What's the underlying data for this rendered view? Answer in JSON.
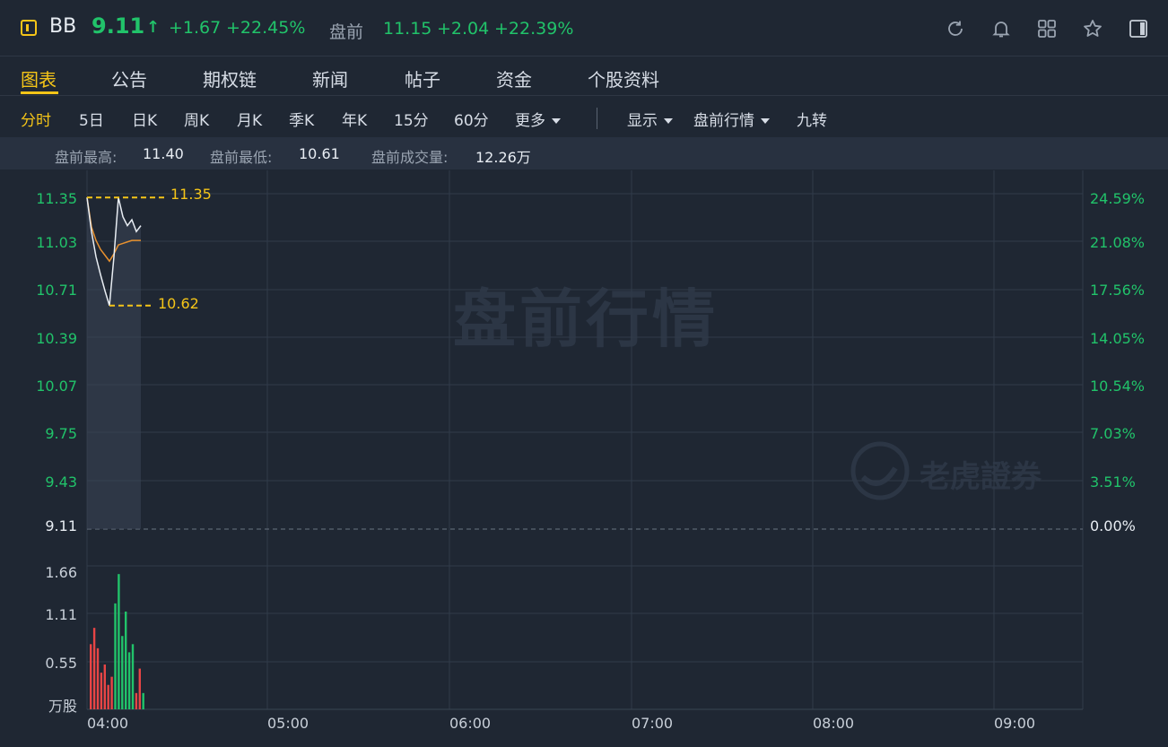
{
  "header": {
    "symbol": "BB",
    "price": "9.11",
    "arrow": "↑",
    "change": "+1.67",
    "change_pct": "+22.45%",
    "premarket_label": "盘前",
    "premarket_price": "11.15",
    "premarket_change": "+2.04",
    "premarket_pct": "+22.39%",
    "icons": [
      "refresh-icon",
      "bell-icon",
      "grid-icon",
      "star-icon",
      "panel-icon"
    ]
  },
  "tabs": [
    "图表",
    "公告",
    "期权链",
    "新闻",
    "帖子",
    "资金",
    "个股资料"
  ],
  "periods": [
    "分时",
    "5日",
    "日K",
    "周K",
    "月K",
    "季K",
    "年K",
    "15分",
    "60分",
    "更多"
  ],
  "options": {
    "display": "显示",
    "session": "盘前行情",
    "nine": "九转"
  },
  "stats": {
    "high_label": "盘前最高:",
    "high": "11.40",
    "low_label": "盘前最低:",
    "low": "10.61",
    "volume_label": "盘前成交量:",
    "volume": "12.26万"
  },
  "chart": {
    "price_axis": [
      "11.35",
      "11.03",
      "10.71",
      "10.39",
      "10.07",
      "9.75",
      "9.43",
      "9.11"
    ],
    "pct_axis": [
      "24.59%",
      "21.08%",
      "17.56%",
      "14.05%",
      "10.54%",
      "7.03%",
      "3.51%",
      "0.00%"
    ],
    "volume_axis": [
      "1.66",
      "1.11",
      "0.55",
      "万股"
    ],
    "time_axis": [
      "04:00",
      "05:00",
      "06:00",
      "07:00",
      "08:00",
      "09:00"
    ],
    "max_marker": "11.35",
    "min_marker": "10.62",
    "watermark": "盘前行情",
    "brand": "老虎證券",
    "colors": {
      "up": "#21c36a",
      "down": "#e84545",
      "avg": "#e8912f",
      "marker": "#f5c518"
    }
  },
  "chart_data": {
    "type": "line",
    "series": [
      {
        "values": [
          11.35,
          11.12,
          10.95,
          10.83,
          10.72,
          10.62,
          10.95,
          11.35,
          11.22,
          11.16,
          11.2,
          11.12,
          11.16
        ]
      },
      {
        "values": [
          11.35,
          11.15,
          11.06,
          11.0,
          10.96,
          10.92,
          10.97,
          11.03,
          11.04,
          11.05,
          11.06,
          11.06,
          11.06
        ]
      }
    ],
    "ylim": [
      9.11,
      11.4
    ],
    "volume": {
      "values": [
        0.8,
        1.0,
        0.75,
        0.45,
        0.55,
        0.3,
        0.4,
        1.3,
        1.66,
        0.9,
        1.2,
        0.7,
        0.8,
        0.2,
        0.5,
        0.2
      ],
      "direction": [
        "down",
        "down",
        "down",
        "down",
        "down",
        "down",
        "down",
        "up",
        "up",
        "up",
        "up",
        "up",
        "up",
        "down",
        "down",
        "up"
      ],
      "ylim": [
        0,
        1.75
      ]
    }
  }
}
